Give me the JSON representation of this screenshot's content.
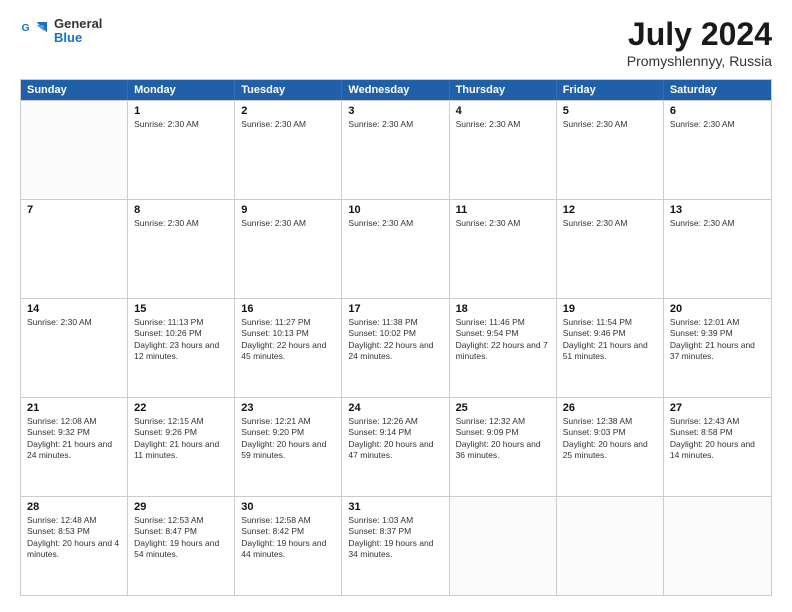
{
  "header": {
    "logo_line1": "General",
    "logo_line2": "Blue",
    "month_year": "July 2024",
    "location": "Promyshlennyy, Russia"
  },
  "weekdays": [
    "Sunday",
    "Monday",
    "Tuesday",
    "Wednesday",
    "Thursday",
    "Friday",
    "Saturday"
  ],
  "rows": [
    [
      {
        "day": "",
        "info": ""
      },
      {
        "day": "1",
        "info": "Sunrise: 2:30 AM"
      },
      {
        "day": "2",
        "info": "Sunrise: 2:30 AM"
      },
      {
        "day": "3",
        "info": "Sunrise: 2:30 AM"
      },
      {
        "day": "4",
        "info": "Sunrise: 2:30 AM"
      },
      {
        "day": "5",
        "info": "Sunrise: 2:30 AM"
      },
      {
        "day": "6",
        "info": "Sunrise: 2:30 AM"
      }
    ],
    [
      {
        "day": "7",
        "info": ""
      },
      {
        "day": "8",
        "info": "Sunrise: 2:30 AM"
      },
      {
        "day": "9",
        "info": "Sunrise: 2:30 AM"
      },
      {
        "day": "10",
        "info": "Sunrise: 2:30 AM"
      },
      {
        "day": "11",
        "info": "Sunrise: 2:30 AM"
      },
      {
        "day": "12",
        "info": "Sunrise: 2:30 AM"
      },
      {
        "day": "13",
        "info": "Sunrise: 2:30 AM"
      }
    ],
    [
      {
        "day": "14",
        "info": "Sunrise: 2:30 AM"
      },
      {
        "day": "15",
        "info": "Sunrise: 11:13 PM\nSunset: 10:26 PM\nDaylight: 23 hours and 12 minutes."
      },
      {
        "day": "16",
        "info": "Sunrise: 11:27 PM\nSunset: 10:13 PM\nDaylight: 22 hours and 45 minutes."
      },
      {
        "day": "17",
        "info": "Sunrise: 11:38 PM\nSunset: 10:02 PM\nDaylight: 22 hours and 24 minutes."
      },
      {
        "day": "18",
        "info": "Sunrise: 11:46 PM\nSunset: 9:54 PM\nDaylight: 22 hours and 7 minutes."
      },
      {
        "day": "19",
        "info": "Sunrise: 11:54 PM\nSunset: 9:46 PM\nDaylight: 21 hours and 51 minutes."
      },
      {
        "day": "20",
        "info": "Sunrise: 12:01 AM\nSunset: 9:39 PM\nDaylight: 21 hours and 37 minutes."
      }
    ],
    [
      {
        "day": "21",
        "info": "Sunrise: 12:08 AM\nSunset: 9:32 PM\nDaylight: 21 hours and 24 minutes."
      },
      {
        "day": "22",
        "info": "Sunrise: 12:15 AM\nSunset: 9:26 PM\nDaylight: 21 hours and 11 minutes."
      },
      {
        "day": "23",
        "info": "Sunrise: 12:21 AM\nSunset: 9:20 PM\nDaylight: 20 hours and 59 minutes."
      },
      {
        "day": "24",
        "info": "Sunrise: 12:26 AM\nSunset: 9:14 PM\nDaylight: 20 hours and 47 minutes."
      },
      {
        "day": "25",
        "info": "Sunrise: 12:32 AM\nSunset: 9:09 PM\nDaylight: 20 hours and 36 minutes."
      },
      {
        "day": "26",
        "info": "Sunrise: 12:38 AM\nSunset: 9:03 PM\nDaylight: 20 hours and 25 minutes."
      },
      {
        "day": "27",
        "info": "Sunrise: 12:43 AM\nSunset: 8:58 PM\nDaylight: 20 hours and 14 minutes."
      }
    ],
    [
      {
        "day": "28",
        "info": "Sunrise: 12:48 AM\nSunset: 8:53 PM\nDaylight: 20 hours and 4 minutes."
      },
      {
        "day": "29",
        "info": "Sunrise: 12:53 AM\nSunset: 8:47 PM\nDaylight: 19 hours and 54 minutes."
      },
      {
        "day": "30",
        "info": "Sunrise: 12:58 AM\nSunset: 8:42 PM\nDaylight: 19 hours and 44 minutes."
      },
      {
        "day": "31",
        "info": "Sunrise: 1:03 AM\nSunset: 8:37 PM\nDaylight: 19 hours and 34 minutes."
      },
      {
        "day": "",
        "info": ""
      },
      {
        "day": "",
        "info": ""
      },
      {
        "day": "",
        "info": ""
      }
    ]
  ]
}
